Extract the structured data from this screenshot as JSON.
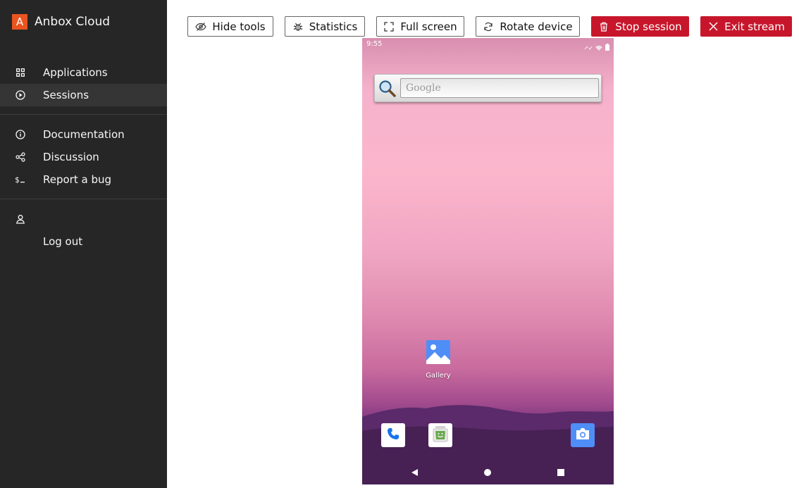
{
  "brand": {
    "logo_letter": "A",
    "name": "Anbox Cloud",
    "accent": "#e95420"
  },
  "sidebar": {
    "primary": [
      {
        "label": "Applications",
        "icon": "grid-icon"
      },
      {
        "label": "Sessions",
        "icon": "play-circle-icon",
        "active": true
      }
    ],
    "secondary": [
      {
        "label": "Documentation",
        "icon": "info-icon"
      },
      {
        "label": "Discussion",
        "icon": "share-icon"
      },
      {
        "label": "Report a bug",
        "icon": "terminal-icon"
      }
    ],
    "account": {
      "icon": "user-icon",
      "logout_label": "Log out"
    }
  },
  "toolbar": {
    "hide_tools": "Hide tools",
    "statistics": "Statistics",
    "full_screen": "Full screen",
    "rotate_device": "Rotate device",
    "stop_session": "Stop session",
    "exit_stream": "Exit stream",
    "negative_color": "#c7162b"
  },
  "device": {
    "status_time": "9:55",
    "search_placeholder": "Google",
    "apps": [
      {
        "label": "Gallery",
        "icon": "gallery-icon"
      }
    ],
    "dock": [
      {
        "icon": "phone-icon"
      },
      {
        "icon": "android-store-icon"
      },
      {
        "icon": "camera-icon"
      }
    ],
    "nav": [
      "back-icon",
      "home-icon",
      "recents-icon"
    ]
  }
}
